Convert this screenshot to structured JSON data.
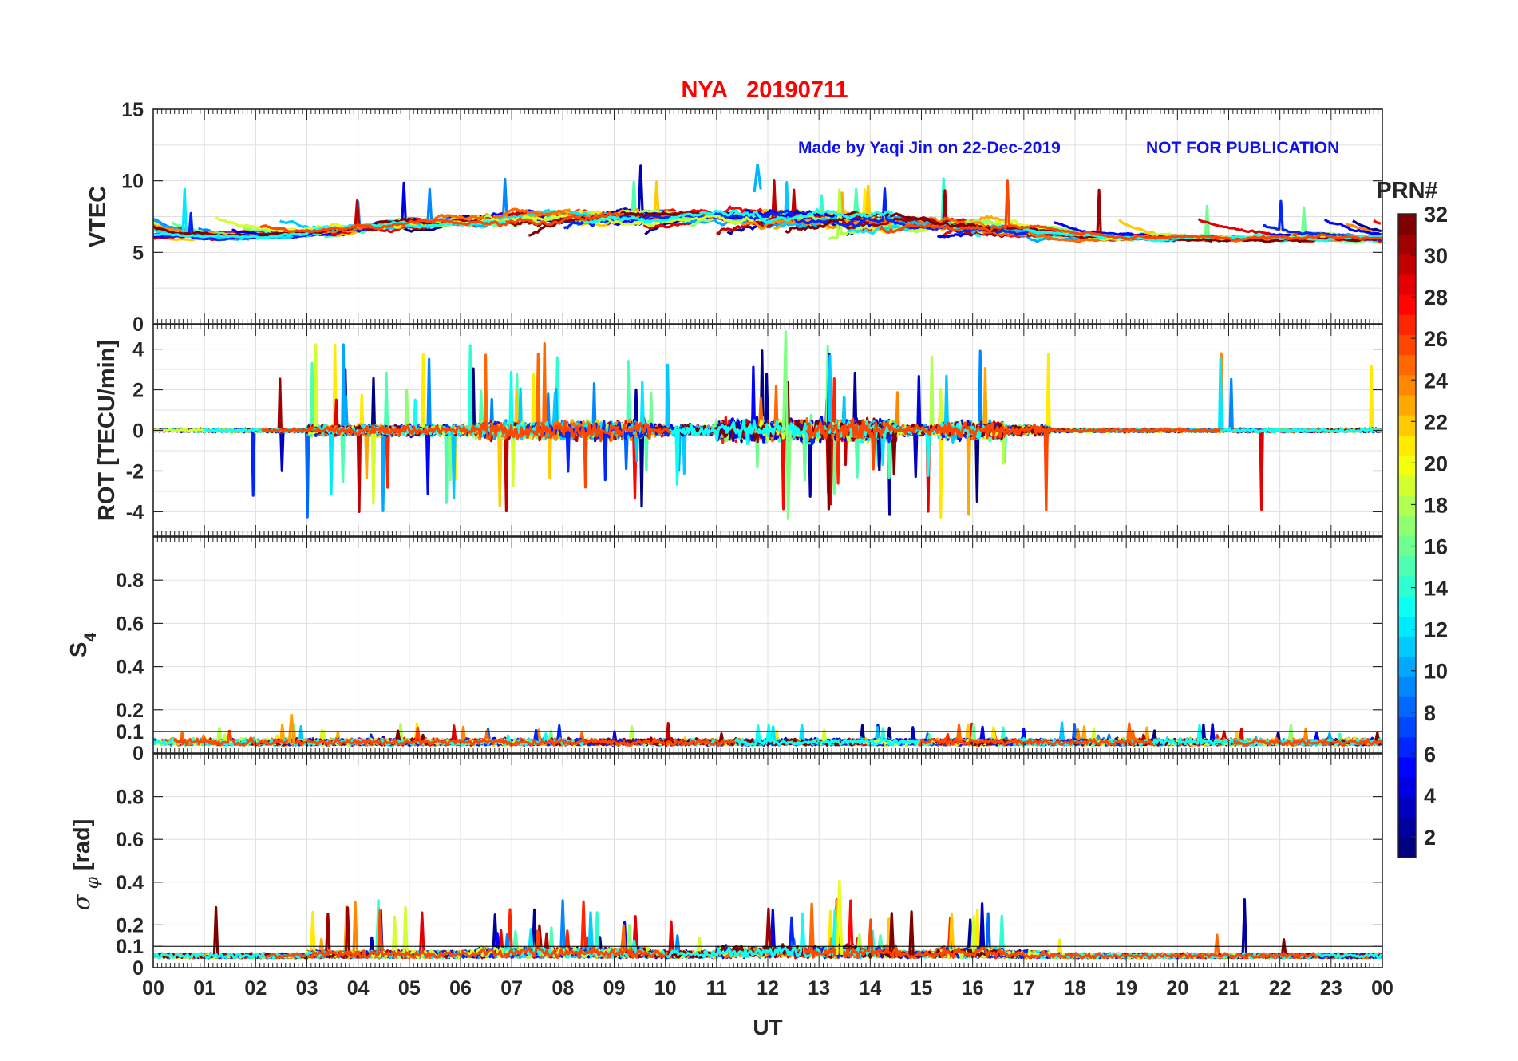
{
  "chart_data": {
    "type": "line",
    "title": "NYA   20190711",
    "annotations": {
      "credit": "Made by Yaqi Jin on 22-Dec-2019",
      "notice": "NOT FOR PUBLICATION"
    },
    "xlabel": "UT",
    "x_ticks": [
      "00",
      "01",
      "02",
      "03",
      "04",
      "05",
      "06",
      "07",
      "08",
      "09",
      "10",
      "11",
      "12",
      "13",
      "14",
      "15",
      "16",
      "17",
      "18",
      "19",
      "20",
      "21",
      "22",
      "23",
      "00"
    ],
    "xlim": [
      0,
      24
    ],
    "grid": true,
    "colorbar": {
      "label": "PRN#",
      "range": [
        1,
        32
      ],
      "ticks": [
        "2",
        "4",
        "6",
        "8",
        "10",
        "12",
        "14",
        "16",
        "18",
        "20",
        "22",
        "24",
        "26",
        "28",
        "30",
        "32"
      ],
      "colormap": "jet"
    },
    "panels": [
      {
        "name": "vtec",
        "ylabel": "VTEC",
        "ylim": [
          0,
          15
        ],
        "yticks": [
          "0",
          "5",
          "10",
          "15"
        ],
        "typical_range": [
          5,
          10
        ],
        "peak_value": 11.2,
        "peak_time_ut": 11.8
      },
      {
        "name": "rot",
        "ylabel": "ROT [TECU/min]",
        "ylim": [
          -5.2,
          5.2
        ],
        "yticks": [
          "-4",
          "-2",
          "0",
          "2",
          "4"
        ],
        "max_value": 4.9,
        "min_value": -4.4,
        "active_period_ut": [
          3,
          17.5
        ]
      },
      {
        "name": "s4",
        "ylabel": "S4",
        "ylim": [
          0,
          1
        ],
        "yticks": [
          "0",
          "0.1",
          "0.2",
          "0.4",
          "0.6",
          "0.8"
        ],
        "baseline": 0.05,
        "max_value": 0.18,
        "reference_line": 0.1
      },
      {
        "name": "sigma_phi",
        "ylabel": "σφ [rad]",
        "ylabel_parts": {
          "symbol": "σ",
          "subscript": "φ",
          "unit": "[rad]"
        },
        "ylim": [
          0,
          1
        ],
        "yticks": [
          "0",
          "0.1",
          "0.2",
          "0.4",
          "0.6",
          "0.8"
        ],
        "baseline": 0.06,
        "max_value": 0.41,
        "reference_line": 0.1
      }
    ]
  }
}
